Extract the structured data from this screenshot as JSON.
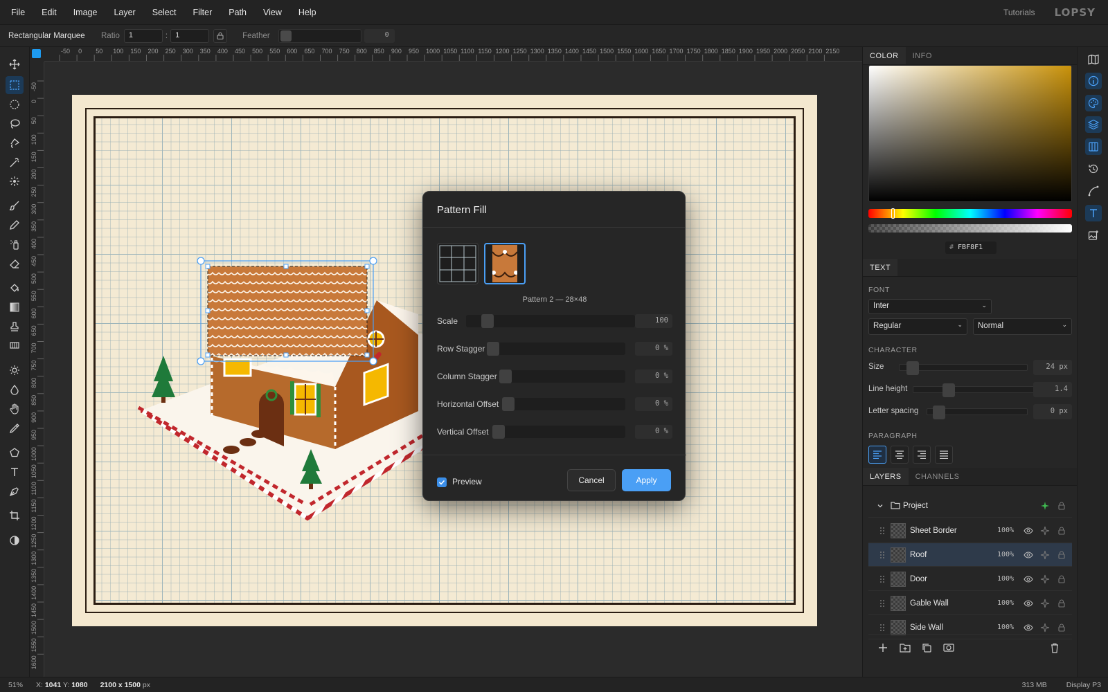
{
  "menu": {
    "items": [
      "File",
      "Edit",
      "Image",
      "Layer",
      "Select",
      "Filter",
      "Path",
      "View",
      "Help"
    ],
    "tutorials": "Tutorials",
    "logo": "LOPSY"
  },
  "options": {
    "tool_name": "Rectangular Marquee",
    "ratio_label": "Ratio",
    "ratio_w": "1",
    "ratio_sep": ":",
    "ratio_h": "1",
    "feather_label": "Feather",
    "feather_value": "0"
  },
  "toolbar": {
    "active_tool": "rectangular-marquee",
    "tools": [
      "move",
      "rectangular-marquee",
      "elliptical-marquee",
      "lasso",
      "polygonal-lasso",
      "magic-wand",
      "quick-select",
      "brush",
      "pencil",
      "spray",
      "eraser",
      "paint-bucket",
      "gradient",
      "stamp",
      "pattern",
      "dodge",
      "blur",
      "hand",
      "eyedropper",
      "polygon-shape",
      "text",
      "pen",
      "crop",
      "contrast"
    ]
  },
  "rulers": {
    "top_labels": [
      "-50",
      "0",
      "50",
      "100",
      "150",
      "200",
      "250",
      "300",
      "350",
      "400",
      "450",
      "500",
      "550",
      "600",
      "650",
      "700",
      "750",
      "800",
      "850",
      "900",
      "950",
      "1000",
      "1050",
      "1100",
      "1150",
      "1200",
      "1250",
      "1300",
      "1350",
      "1400",
      "1450",
      "1500",
      "1550",
      "1600",
      "1650",
      "1700",
      "1750",
      "1800",
      "1850",
      "1900",
      "1950",
      "2000",
      "2050",
      "2100",
      "2150"
    ],
    "left_labels": [
      "-50",
      "0",
      "50",
      "100",
      "150",
      "200",
      "250",
      "300",
      "350",
      "400",
      "450",
      "500",
      "550",
      "600",
      "650",
      "700",
      "750",
      "800",
      "850",
      "900",
      "950",
      "1000",
      "1050",
      "1100",
      "1150",
      "1200",
      "1250",
      "1300",
      "1350",
      "1400",
      "1450",
      "1500",
      "1550",
      "1600"
    ]
  },
  "dialog": {
    "title": "Pattern Fill",
    "pattern_caption": "Pattern 2 — 28×48",
    "selected_pattern": 2,
    "sliders": [
      {
        "label": "Scale",
        "value": "100",
        "level": 0.05
      },
      {
        "label": "Row Stagger",
        "value": "0 %",
        "level": 0.0
      },
      {
        "label": "Column Stagger",
        "value": "0 %",
        "level": 0.0
      },
      {
        "label": "Horizontal Offset",
        "value": "0 %",
        "level": 0.0
      },
      {
        "label": "Vertical Offset",
        "value": "0 %",
        "level": 0.0
      }
    ],
    "preview_label": "Preview",
    "preview_checked": true,
    "cancel_label": "Cancel",
    "apply_label": "Apply"
  },
  "color_panel": {
    "tabs": [
      "COLOR",
      "INFO"
    ],
    "hex_prefix": "#",
    "hex": "FBF8F1",
    "hue_color": "#c9920a"
  },
  "text_panel": {
    "tab": "TEXT",
    "font_title": "FONT",
    "font_family": "Inter",
    "font_style": "Regular",
    "font_variant": "Normal",
    "character_title": "CHARACTER",
    "rows": [
      {
        "label": "Size",
        "value": "24 px"
      },
      {
        "label": "Line height",
        "value": "1.4"
      },
      {
        "label": "Letter spacing",
        "value": "0 px"
      }
    ],
    "paragraph_title": "PARAGRAPH"
  },
  "layers_panel": {
    "tabs": [
      "LAYERS",
      "CHANNELS"
    ],
    "group_name": "Project",
    "layers": [
      {
        "name": "Sheet Border",
        "opacity": "100%",
        "selected": false
      },
      {
        "name": "Roof",
        "opacity": "100%",
        "selected": true
      },
      {
        "name": "Door",
        "opacity": "100%",
        "selected": false
      },
      {
        "name": "Gable Wall",
        "opacity": "100%",
        "selected": false
      },
      {
        "name": "Side Wall",
        "opacity": "100%",
        "selected": false
      }
    ]
  },
  "status": {
    "zoom": "51%",
    "x_label": "X:",
    "x": "1041",
    "y_label": "Y:",
    "y": "1080",
    "doc_size": "2100 x 1500",
    "doc_unit": "px",
    "memory": "313 MB",
    "color_profile": "Display P3"
  },
  "colors": {
    "accent": "#4a9ff5",
    "paper": "#f4e8cf",
    "frame": "#2b1d12"
  }
}
